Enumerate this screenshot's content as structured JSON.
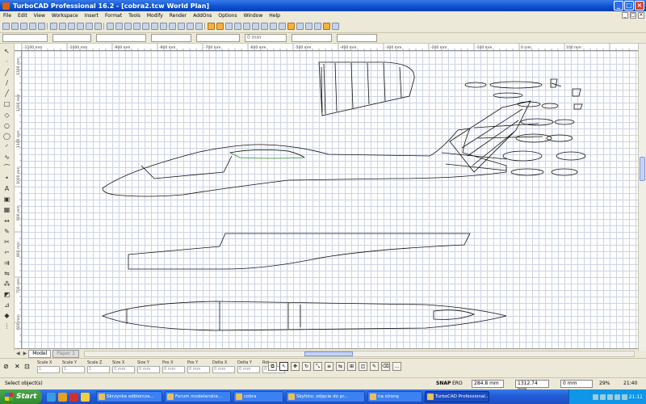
{
  "window": {
    "title": "TurboCAD Professional 16.2 - [cobra2.tcw World Plan]"
  },
  "menu": [
    "File",
    "Edit",
    "View",
    "Workspace",
    "Insert",
    "Format",
    "Tools",
    "Modify",
    "Render",
    "AddOns",
    "Options",
    "Window",
    "Help"
  ],
  "toolbar2": {
    "field_value": "0 mm"
  },
  "ruler": {
    "h_ticks": [
      "-1100 mm",
      "-1000 mm",
      "-900 mm",
      "-800 mm",
      "-700 mm",
      "-600 mm",
      "-500 mm",
      "-400 mm",
      "-300 mm",
      "-200 mm",
      "-100 mm",
      "0 mm",
      "100 mm"
    ],
    "v_ticks": [
      "1300 mm",
      "1200 mm",
      "1100 mm",
      "1000 mm",
      "900 mm",
      "800 mm",
      "700 mm",
      "600 mm"
    ]
  },
  "tabs": {
    "model": "Model",
    "paper": "Paper 1"
  },
  "inspector": {
    "fields": [
      {
        "label": "Scale X",
        "value": "1"
      },
      {
        "label": "Scale Y",
        "value": "1"
      },
      {
        "label": "Scale Z",
        "value": "1"
      },
      {
        "label": "Size X",
        "value": "0 mm"
      },
      {
        "label": "Size Y",
        "value": "0 mm"
      },
      {
        "label": "Pos X",
        "value": "0 mm"
      },
      {
        "label": "Pos Y",
        "value": "0 mm"
      },
      {
        "label": "Delta X",
        "value": "0 mm"
      },
      {
        "label": "Delta Y",
        "value": "0 mm"
      },
      {
        "label": "Rot",
        "value": "0"
      }
    ]
  },
  "status": {
    "prompt": "Select object(s)",
    "snap_label": "SNAP",
    "snap_value": "ERO",
    "coord_x": "284.8 mm",
    "coord_y": "1312.74 mm",
    "coord_z": "0 mm",
    "zoom": "29%",
    "time": "21:40"
  },
  "taskbar": {
    "start": "Start",
    "tasks": [
      "Skrzynka odbiorcza...",
      "Forum modelarskie...",
      "cobra",
      "Skyfoto: zdjęcie do pr...",
      "na stronę",
      "TurboCAD Professional..."
    ],
    "clock": "21:11"
  }
}
